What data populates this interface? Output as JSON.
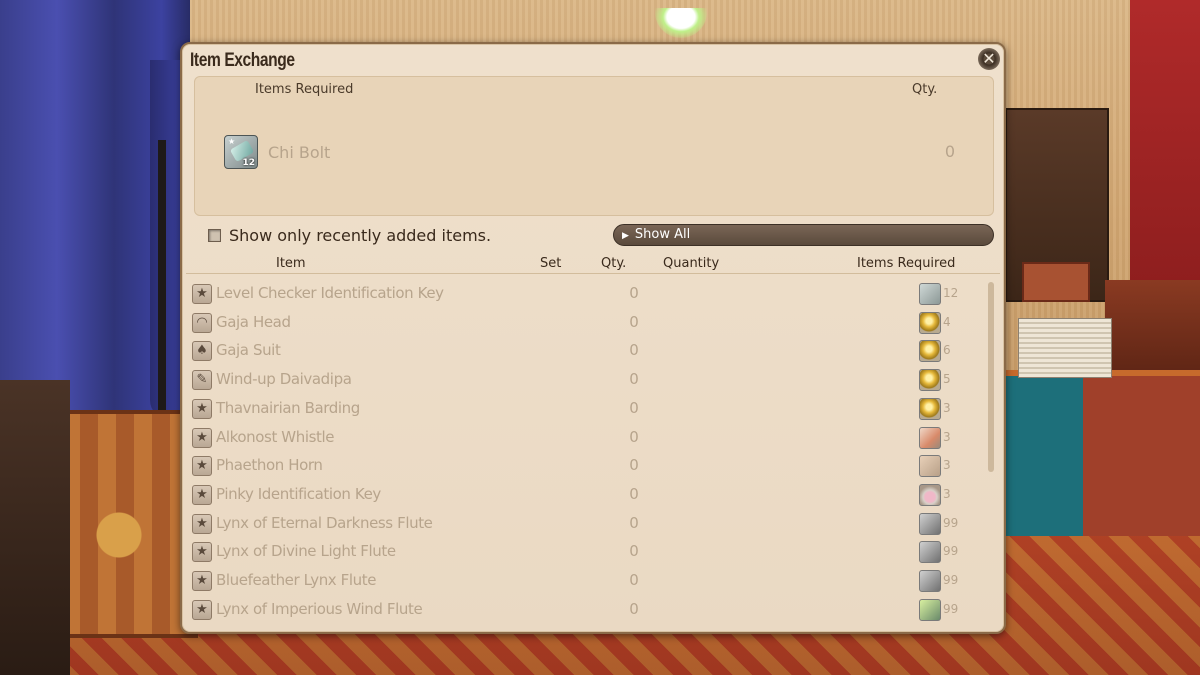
{
  "window": {
    "title": "Item Exchange",
    "close_label": "✕"
  },
  "required_panel": {
    "header_items": "Items Required",
    "header_qty": "Qty.",
    "item_name": "Chi Bolt",
    "item_qty": "0",
    "item_level": "12",
    "item_icon": "chi-bolt-icon"
  },
  "filter": {
    "checkbox_label": "Show only recently added items.",
    "checked": false,
    "dropdown_label": "Show All"
  },
  "table": {
    "columns": {
      "item": "Item",
      "set": "Set",
      "qty": "Qty.",
      "quantity": "Quantity",
      "items_required": "Items Required"
    },
    "rows": [
      {
        "icon": "star-icon",
        "name": "Level Checker Identification Key",
        "qty": "0",
        "cost_icon": "chi-bolt-icon",
        "cost": "12"
      },
      {
        "icon": "helmet-icon",
        "name": "Gaja Head",
        "qty": "0",
        "cost_icon": "gold-orb-icon",
        "cost": "4"
      },
      {
        "icon": "armor-icon",
        "name": "Gaja Suit",
        "qty": "0",
        "cost_icon": "gold-orb-icon",
        "cost": "6"
      },
      {
        "icon": "toy-icon",
        "name": "Wind-up Daivadipa",
        "qty": "0",
        "cost_icon": "gold-orb-icon",
        "cost": "5"
      },
      {
        "icon": "star-icon",
        "name": "Thavnairian Barding",
        "qty": "0",
        "cost_icon": "gold-orb-icon",
        "cost": "3"
      },
      {
        "icon": "star-icon",
        "name": "Alkonost Whistle",
        "qty": "0",
        "cost_icon": "whistle-icon",
        "cost": "3"
      },
      {
        "icon": "star-icon",
        "name": "Phaethon Horn",
        "qty": "0",
        "cost_icon": "horn-icon",
        "cost": "3"
      },
      {
        "icon": "star-icon",
        "name": "Pinky Identification Key",
        "qty": "0",
        "cost_icon": "vial-icon",
        "cost": "3"
      },
      {
        "icon": "star-icon",
        "name": "Lynx of Eternal Darkness Flute",
        "qty": "0",
        "cost_icon": "chain-icon",
        "cost": "99"
      },
      {
        "icon": "star-icon",
        "name": "Lynx of Divine Light Flute",
        "qty": "0",
        "cost_icon": "chain-icon",
        "cost": "99"
      },
      {
        "icon": "star-icon",
        "name": "Bluefeather Lynx Flute",
        "qty": "0",
        "cost_icon": "chain-icon",
        "cost": "99"
      },
      {
        "icon": "star-icon",
        "name": "Lynx of Imperious Wind Flute",
        "qty": "0",
        "cost_icon": "green-chain-icon",
        "cost": "99"
      }
    ]
  },
  "colors": {
    "window_bg": "#ead9c3",
    "text_dark": "#3a2a1c",
    "text_muted": "#b7a48c",
    "dropdown_bg": "#5a4a3c"
  }
}
